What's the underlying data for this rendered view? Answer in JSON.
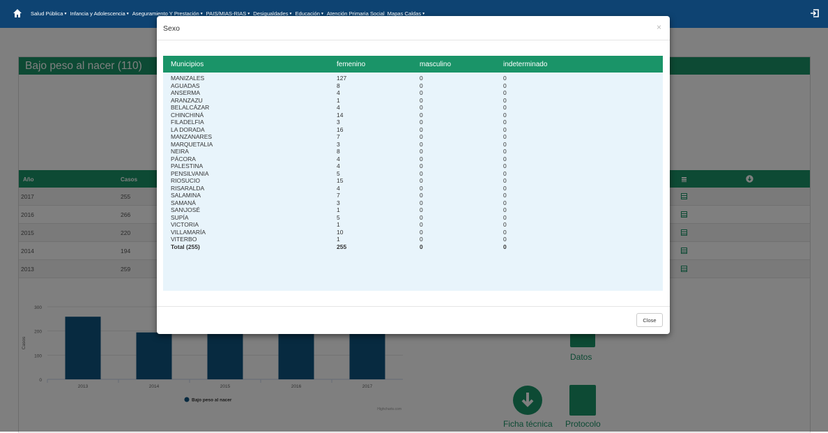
{
  "navbar": {
    "menu": [
      {
        "label": "Salud Pública",
        "has_caret": true
      },
      {
        "label": "Infancia y Adolescencia",
        "has_caret": true
      },
      {
        "label": "Aseguramiento Y Prestación",
        "has_caret": true
      },
      {
        "label": "PAIS/MIAS-RIAS",
        "has_caret": true
      },
      {
        "label": "Desigualdades",
        "has_caret": true
      },
      {
        "label": "Educación",
        "has_caret": true
      },
      {
        "label": "Atención Primaria Social",
        "has_caret": false
      },
      {
        "label": "Mapas Caldas",
        "has_caret": true
      }
    ],
    "icons": {
      "home": "home-icon",
      "logout": "logout-icon"
    }
  },
  "panel": {
    "title": "Bajo peso al nacer (110)",
    "table": {
      "headers": [
        "Año",
        "Casos"
      ],
      "rows": [
        {
          "year": "2017",
          "cases": "255"
        },
        {
          "year": "2016",
          "cases": "266"
        },
        {
          "year": "2015",
          "cases": "220"
        },
        {
          "year": "2014",
          "cases": "194"
        },
        {
          "year": "2013",
          "cases": "259"
        }
      ]
    },
    "links": {
      "datos": "Datos",
      "ficha": "Ficha técnica",
      "protocolo": "Protocolo"
    }
  },
  "chart_data": {
    "type": "bar",
    "categories": [
      "2013",
      "2014",
      "2015",
      "2016",
      "2017"
    ],
    "series": [
      {
        "name": "Bajo peso al nacer",
        "values": [
          259,
          194,
          220,
          266,
          255
        ]
      }
    ],
    "ylabel": "Casos",
    "ylim": [
      0,
      300
    ],
    "yticks": [
      "0",
      "100",
      "200",
      "300"
    ],
    "legend": "bottom-center",
    "credits": "Highcharts.com",
    "color": "#0e5580"
  },
  "modal": {
    "title": "Sexo",
    "close_x": "×",
    "close_button": "Close",
    "headers": [
      "Municipios",
      "femenino",
      "masculino",
      "indeterminado"
    ],
    "rows": [
      {
        "municipio": "MANIZALES",
        "femenino": "127",
        "masculino": "0",
        "indeterminado": "0"
      },
      {
        "municipio": "AGUADAS",
        "femenino": "8",
        "masculino": "0",
        "indeterminado": "0"
      },
      {
        "municipio": "ANSERMA",
        "femenino": "4",
        "masculino": "0",
        "indeterminado": "0"
      },
      {
        "municipio": "ARANZAZU",
        "femenino": "1",
        "masculino": "0",
        "indeterminado": "0"
      },
      {
        "municipio": "BELALCÁZAR",
        "femenino": "4",
        "masculino": "0",
        "indeterminado": "0"
      },
      {
        "municipio": "CHINCHINÁ",
        "femenino": "14",
        "masculino": "0",
        "indeterminado": "0"
      },
      {
        "municipio": "FILADELFIA",
        "femenino": "3",
        "masculino": "0",
        "indeterminado": "0"
      },
      {
        "municipio": "LA DORADA",
        "femenino": "16",
        "masculino": "0",
        "indeterminado": "0"
      },
      {
        "municipio": "MANZANARES",
        "femenino": "7",
        "masculino": "0",
        "indeterminado": "0"
      },
      {
        "municipio": "MARQUETALIA",
        "femenino": "3",
        "masculino": "0",
        "indeterminado": "0"
      },
      {
        "municipio": "NEIRA",
        "femenino": "8",
        "masculino": "0",
        "indeterminado": "0"
      },
      {
        "municipio": "PÁCORA",
        "femenino": "4",
        "masculino": "0",
        "indeterminado": "0"
      },
      {
        "municipio": "PALESTINA",
        "femenino": "4",
        "masculino": "0",
        "indeterminado": "0"
      },
      {
        "municipio": "PENSILVANIA",
        "femenino": "5",
        "masculino": "0",
        "indeterminado": "0"
      },
      {
        "municipio": "RIOSUCIO",
        "femenino": "15",
        "masculino": "0",
        "indeterminado": "0"
      },
      {
        "municipio": "RISARALDA",
        "femenino": "4",
        "masculino": "0",
        "indeterminado": "0"
      },
      {
        "municipio": "SALAMINA",
        "femenino": "7",
        "masculino": "0",
        "indeterminado": "0"
      },
      {
        "municipio": "SAMANÁ",
        "femenino": "3",
        "masculino": "0",
        "indeterminado": "0"
      },
      {
        "municipio": "SAN\\JOSÉ",
        "femenino": "1",
        "masculino": "0",
        "indeterminado": "0"
      },
      {
        "municipio": "SUPÍA",
        "femenino": "5",
        "masculino": "0",
        "indeterminado": "0"
      },
      {
        "municipio": "VICTORIA",
        "femenino": "1",
        "masculino": "0",
        "indeterminado": "0"
      },
      {
        "municipio": "VILLAMARÍA",
        "femenino": "10",
        "masculino": "0",
        "indeterminado": "0"
      },
      {
        "municipio": "VITERBO",
        "femenino": "1",
        "masculino": "0",
        "indeterminado": "0"
      }
    ],
    "total": {
      "municipio": "Total (255)",
      "femenino": "255",
      "masculino": "0",
      "indeterminado": "0"
    }
  },
  "colors": {
    "navbar": "#0e4372",
    "accent_green": "#1a9468",
    "table_bg": "#e8f4fb",
    "bar": "#0e5580"
  }
}
